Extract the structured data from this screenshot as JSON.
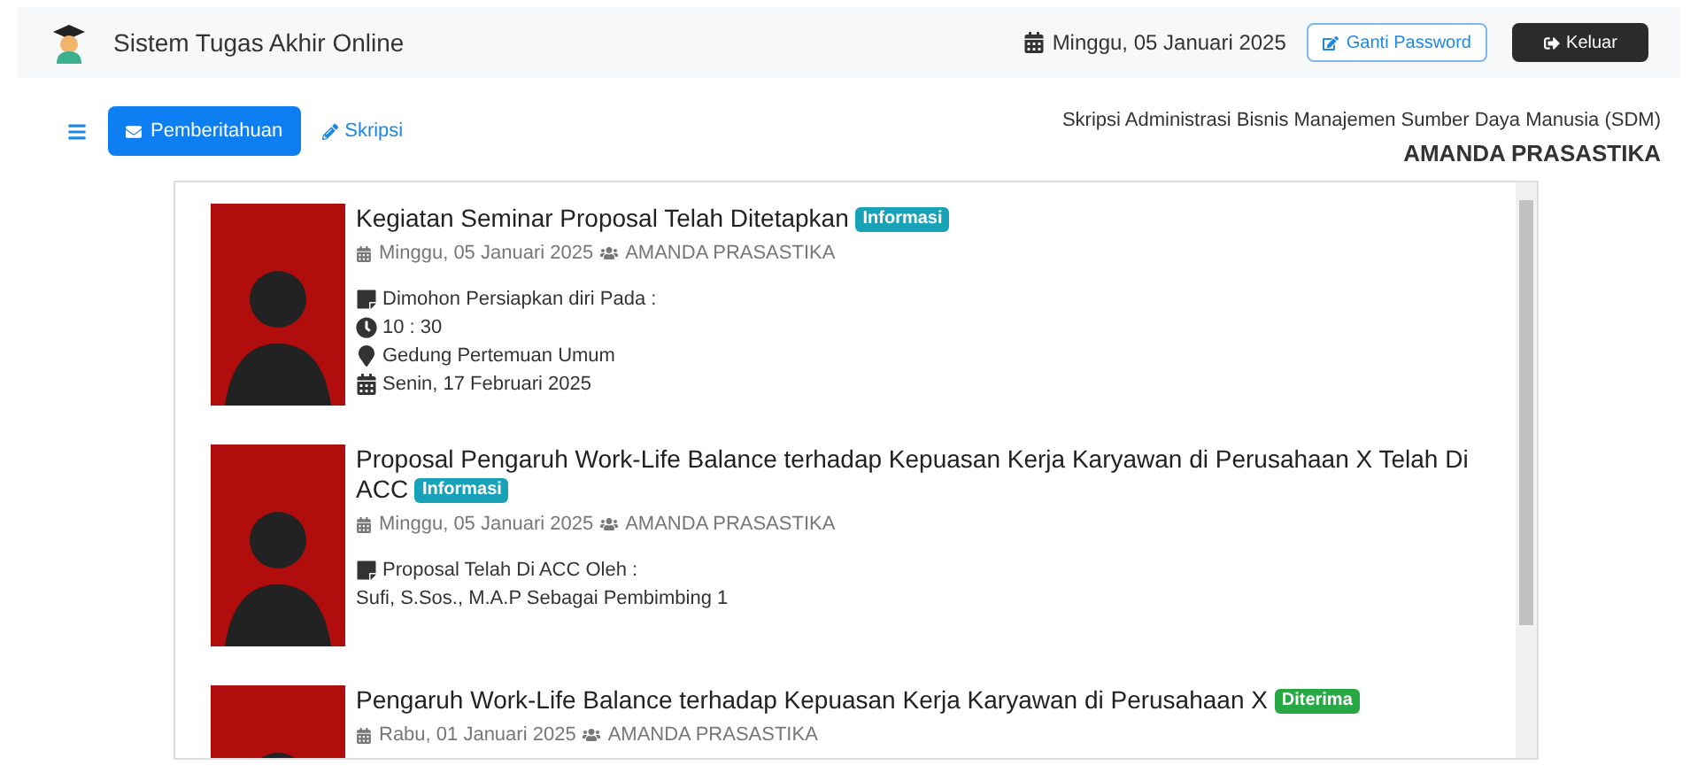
{
  "app_title": "Sistem Tugas Akhir Online",
  "header_date": "Minggu, 05 Januari 2025",
  "buttons": [
    {
      "label": "Ganti Password",
      "kind": "outline"
    },
    {
      "label": "Keluar",
      "kind": "dark"
    }
  ],
  "tabs": [
    {
      "label": "Pemberitahuan",
      "selected": true,
      "kind": "mail"
    },
    {
      "label": "Skripsi",
      "selected": false,
      "kind": "pencil"
    }
  ],
  "program": "Skripsi Administrasi Bisnis Manajemen Sumber Daya Manusia (SDM)",
  "student_name": "AMANDA PRASASTIKA",
  "notifications": [
    {
      "title": "Kegiatan Seminar Proposal Telah Ditetapkan",
      "badge": {
        "label": "Informasi",
        "color": "#17a2b8"
      },
      "date": "Minggu, 05 Januari 2025",
      "author": "AMANDA PRASASTIKA",
      "lines": [
        {
          "kind": "note",
          "text": "Dimohon Persiapkan diri Pada :"
        },
        {
          "kind": "time",
          "text": "10 : 30"
        },
        {
          "kind": "place",
          "text": "Gedung Pertemuan Umum"
        },
        {
          "kind": "date",
          "text": "Senin, 17 Februari 2025"
        }
      ]
    },
    {
      "title": "Proposal Pengaruh Work-Life Balance terhadap Kepuasan Kerja Karyawan di Perusahaan X Telah Di ACC",
      "badge": {
        "label": "Informasi",
        "color": "#17a2b8"
      },
      "date": "Minggu, 05 Januari 2025",
      "author": "AMANDA PRASASTIKA",
      "lines": [
        {
          "kind": "note",
          "text": "Proposal Telah Di ACC Oleh :"
        },
        {
          "kind": "plain",
          "text": "Sufi, S.Sos., M.A.P Sebagai Pembimbing 1"
        }
      ]
    },
    {
      "title": "Pengaruh Work-Life Balance terhadap Kepuasan Kerja Karyawan di Perusahaan X",
      "badge": {
        "label": "Diterima",
        "color": "#28a745"
      },
      "date": "Rabu, 01 Januari 2025",
      "author": "AMANDA PRASASTIKA"
    }
  ]
}
